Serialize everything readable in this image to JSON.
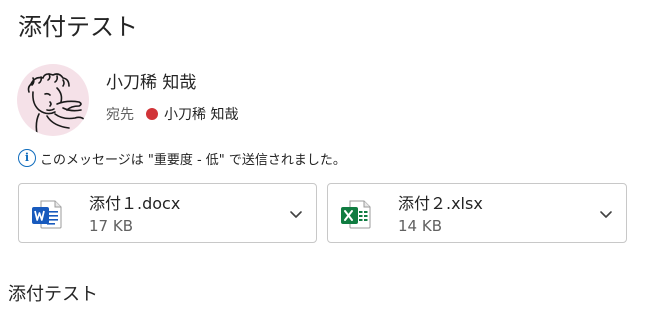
{
  "message": {
    "subject": "添付テスト",
    "sender": {
      "name": "小刀稀 知哉",
      "avatar_icon": "avatar-sketch"
    },
    "recipient_label": "宛先",
    "recipient": {
      "name": "小刀稀 知哉",
      "presence_color": "#d13438"
    },
    "importance_notice": "このメッセージは \"重要度 - 低\" で送信されました。",
    "attachments": [
      {
        "name": "添付１.docx",
        "size": "17 KB",
        "icon": "word-file-icon"
      },
      {
        "name": "添付２.xlsx",
        "size": "14 KB",
        "icon": "excel-file-icon"
      }
    ],
    "body": "添付テスト"
  },
  "colors": {
    "word_blue": "#185abd",
    "excel_green": "#107c41",
    "info_blue": "#0f6cbd",
    "avatar_bg": "#f5e1e8"
  }
}
